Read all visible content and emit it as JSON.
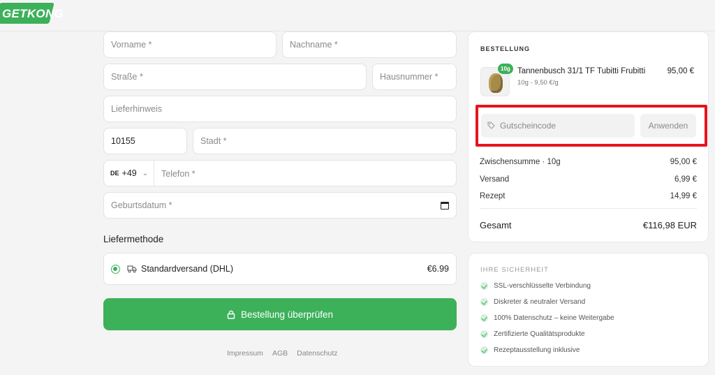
{
  "brand": {
    "logo_text": "GETKONG",
    "accent": "#3db05a"
  },
  "form": {
    "first_name": {
      "placeholder": "Vorname *",
      "value": ""
    },
    "last_name": {
      "placeholder": "Nachname *",
      "value": ""
    },
    "street": {
      "placeholder": "Straße *",
      "value": ""
    },
    "house_number": {
      "placeholder": "Hausnummer *",
      "value": ""
    },
    "delivery_note": {
      "placeholder": "Lieferhinweis",
      "value": ""
    },
    "postal_code": {
      "placeholder": "",
      "value": "10155"
    },
    "city": {
      "placeholder": "Stadt *",
      "value": ""
    },
    "phone": {
      "country_code": "DE",
      "dial_code": "+49",
      "placeholder": "Telefon *",
      "value": ""
    },
    "birthdate": {
      "placeholder": "Geburtsdatum *",
      "value": ""
    }
  },
  "shipping": {
    "title": "Liefermethode",
    "methods": [
      {
        "label": "Standardversand (DHL)",
        "price": "€6.99",
        "selected": true
      }
    ]
  },
  "cta": {
    "label": "Bestellung überprüfen"
  },
  "footer": {
    "links": [
      "Impressum",
      "AGB",
      "Datenschutz"
    ]
  },
  "order": {
    "title": "BESTELLUNG",
    "items": [
      {
        "badge": "10g",
        "name": "Tannenbusch 31/1 TF Tubitti Frubitti",
        "detail": "10g - 9,50 €/g",
        "price": "95,00 €"
      }
    ],
    "coupon": {
      "placeholder": "Gutscheincode",
      "button": "Anwenden"
    },
    "rows": [
      {
        "label": "Zwischensumme · 10g",
        "value": "95,00 €"
      },
      {
        "label": "Versand",
        "value": "6,99 €"
      },
      {
        "label": "Rezept",
        "value": "14,99 €"
      }
    ],
    "total": {
      "label": "Gesamt",
      "value": "€116,98 EUR"
    }
  },
  "security": {
    "title": "IHRE SICHERHEIT",
    "items": [
      "SSL-verschlüsselte Verbindung",
      "Diskreter & neutraler Versand",
      "100% Datenschutz – keine Weitergabe",
      "Zertifizierte Qualitätsprodukte",
      "Rezeptausstellung inklusive"
    ]
  }
}
